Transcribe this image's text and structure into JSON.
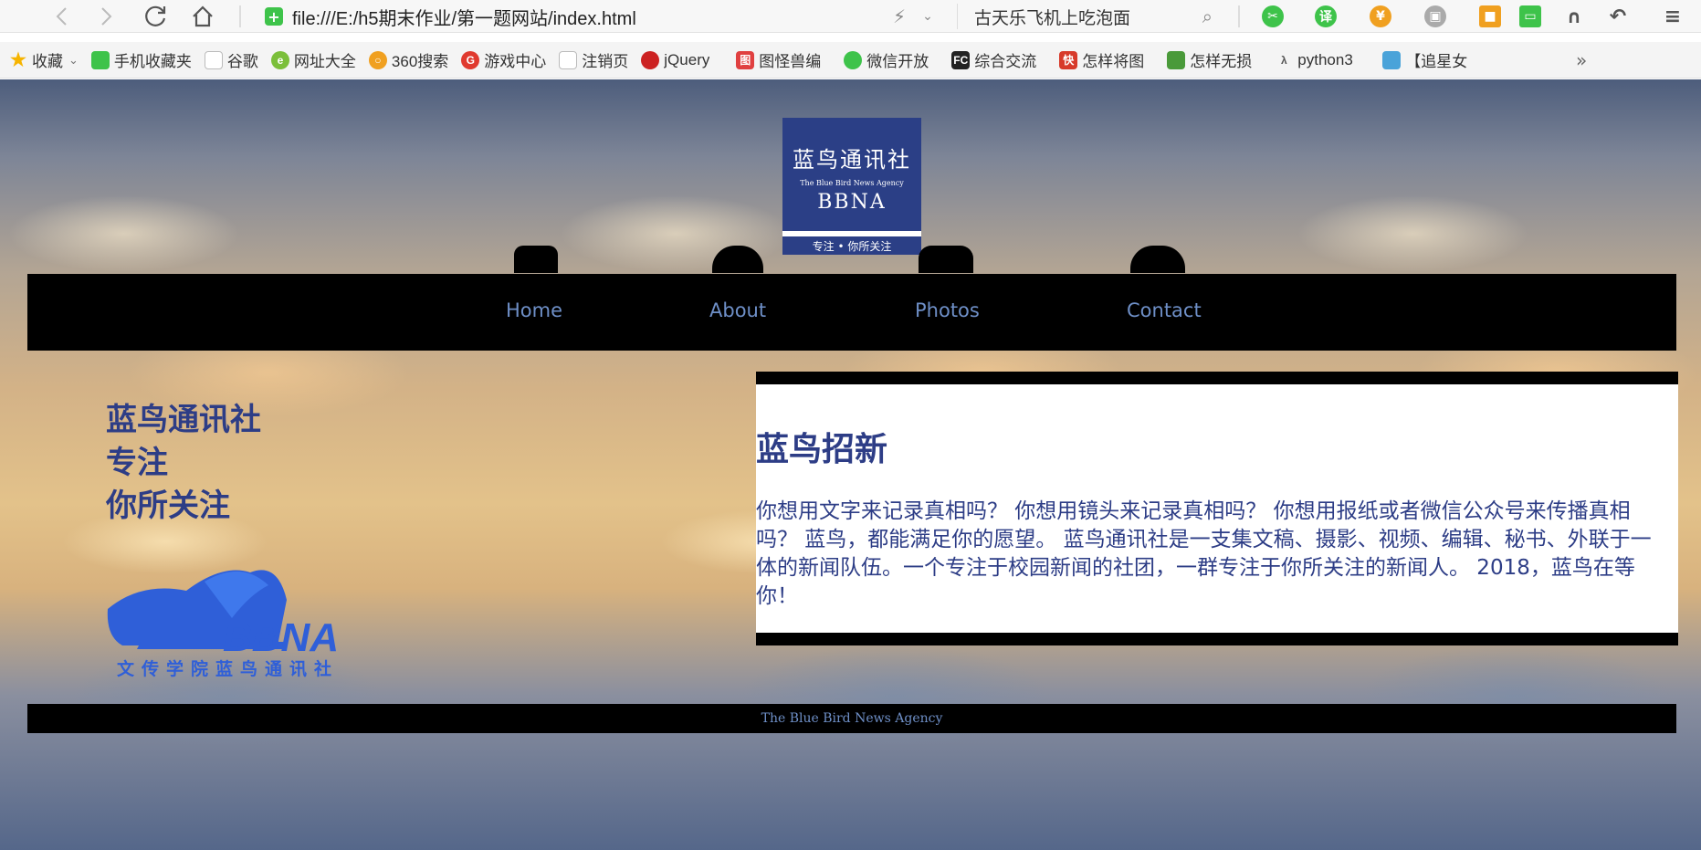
{
  "browser": {
    "address": {
      "url": "file:///E:/h5期末作业/第一题网站/index.html"
    },
    "search": {
      "text": "古天乐飞机上吃泡面"
    }
  },
  "bookmarks": {
    "items": [
      {
        "label": "收藏",
        "color": "#f6b400"
      },
      {
        "label": "手机收藏夹",
        "color": "#3ec34a"
      },
      {
        "label": "谷歌",
        "color": "#bbbbbb"
      },
      {
        "label": "网址大全",
        "color": "#7bbf3a"
      },
      {
        "label": "360搜索",
        "color": "#f0a020"
      },
      {
        "label": "游戏中心",
        "color": "#e03a2f"
      },
      {
        "label": "注销页",
        "color": "#bbbbbb"
      },
      {
        "label": "jQuery",
        "color": "#cc2222"
      },
      {
        "label": "图怪兽编",
        "color": "#e04040"
      },
      {
        "label": "微信开放",
        "color": "#3ec34a"
      },
      {
        "label": "综合交流",
        "color": "#222222"
      },
      {
        "label": "怎样将图",
        "color": "#d73a2a"
      },
      {
        "label": "怎样无损",
        "color": "#4a9a3a"
      },
      {
        "label": "python3",
        "color": "#888888"
      },
      {
        "label": "【追星女",
        "color": "#4aa3d9"
      }
    ],
    "more": "»"
  },
  "site": {
    "logo": {
      "cn": "蓝鸟通讯社",
      "en_small": "The Blue Bird News Agency",
      "abbr": "BBNA",
      "motto": "专注 • 你所关注"
    },
    "nav": {
      "home": "Home",
      "about": "About",
      "photos": "Photos",
      "contact": "Contact"
    },
    "side": {
      "line1": "蓝鸟通讯社",
      "line2": "专注",
      "line3": "你所关注",
      "logo_abbr": "BBNA",
      "logo_school": "文传学院蓝鸟通讯社"
    },
    "article": {
      "title": "蓝鸟招新",
      "body": "你想用文字来记录真相吗？ 你想用镜头来记录真相吗？ 你想用报纸或者微信公众号来传播真相吗？ 蓝鸟，都能满足你的愿望。 蓝鸟通讯社是一支集文稿、摄影、视频、编辑、秘书、外联于一体的新闻队伍。一个专注于校园新闻的社团，一群专注于你所关注的新闻人。 2018，蓝鸟在等你！"
    },
    "footer": "The Blue Bird News Agency"
  }
}
